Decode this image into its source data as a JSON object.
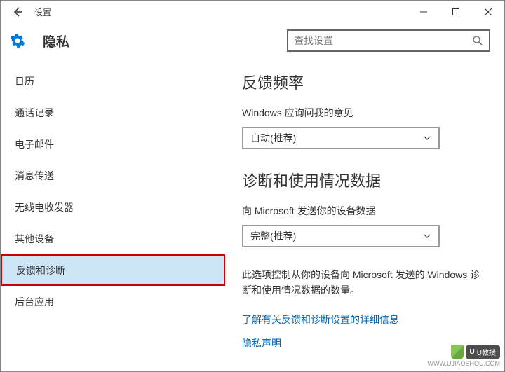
{
  "window": {
    "title": "设置"
  },
  "header": {
    "page_title": "隐私",
    "search_placeholder": "查找设置"
  },
  "sidebar": {
    "items": [
      {
        "label": "日历"
      },
      {
        "label": "通话记录"
      },
      {
        "label": "电子邮件"
      },
      {
        "label": "消息传送"
      },
      {
        "label": "无线电收发器"
      },
      {
        "label": "其他设备"
      },
      {
        "label": "反馈和诊断"
      },
      {
        "label": "后台应用"
      }
    ],
    "selected_index": 6
  },
  "main": {
    "feedback": {
      "title": "反馈频率",
      "label": "Windows 应询问我的意见",
      "value": "自动(推荐)"
    },
    "diagnostic": {
      "title": "诊断和使用情况数据",
      "label": "向 Microsoft 发送你的设备数据",
      "value": "完整(推荐)",
      "description": "此选项控制从你的设备向 Microsoft 发送的 Windows 诊断和使用情况数据的数量。",
      "link_learn": "了解有关反馈和诊断设置的详细信息",
      "link_privacy": "隐私声明"
    }
  },
  "watermark": {
    "badge": "U教授",
    "url": "WWW.UJIAOSHOU.COM"
  }
}
